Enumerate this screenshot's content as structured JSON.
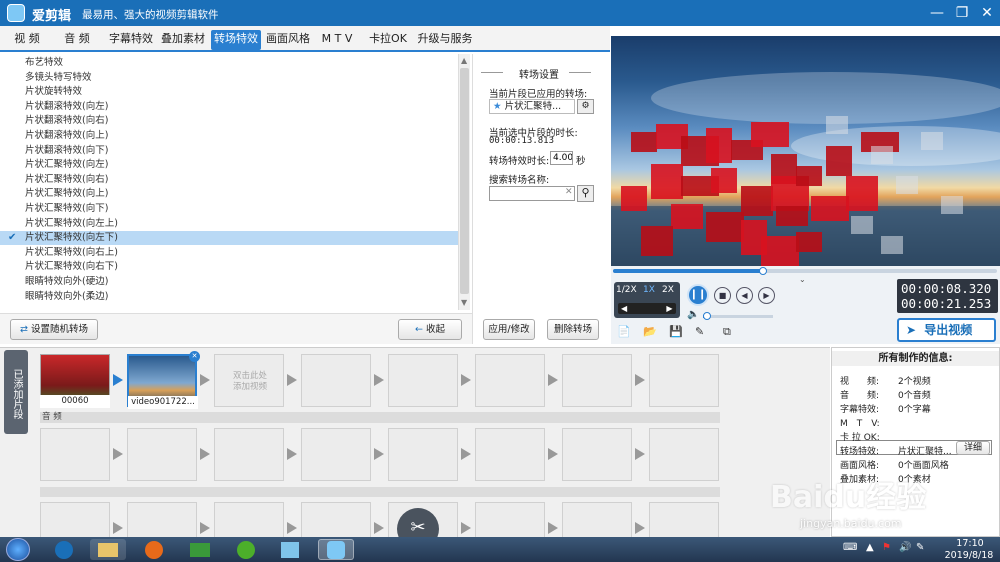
{
  "app": {
    "name": "爱剪辑",
    "slogan": "最易用、强大的视频剪辑软件"
  },
  "window_controls": [
    "minimize-icon",
    "restore-icon",
    "close-icon"
  ],
  "tabs": [
    "视 频",
    "音 频",
    "字幕特效",
    "叠加素材",
    "转场特效",
    "画面风格",
    "M T V",
    "卡拉OK",
    "升级与服务"
  ],
  "active_tab": "转场特效",
  "effects": [
    "布艺特效",
    "多镜头特写特效",
    "片状旋转特效",
    "片状翻滚特效(向左)",
    "片状翻滚特效(向右)",
    "片状翻滚特效(向上)",
    "片状翻滚特效(向下)",
    "片状汇聚特效(向左)",
    "片状汇聚特效(向右)",
    "片状汇聚特效(向上)",
    "片状汇聚特效(向下)",
    "片状汇聚特效(向左上)",
    "片状汇聚特效(向左下)",
    "片状汇聚特效(向右上)",
    "片状汇聚特效(向右下)",
    "眼睛特效向外(硬边)",
    "眼睛特效向外(柔边)"
  ],
  "selected_effect_index": 12,
  "bottom": {
    "random_btn": "设置随机转场",
    "collapse_btn": "收起"
  },
  "settings": {
    "title": "转场设置",
    "applied_label": "当前片段已应用的转场:",
    "applied_value": "片状汇聚特...",
    "duration_label": "当前选中片段的时长:",
    "duration_value": "00:00:13.813",
    "effect_len_label": "转场特效时长:",
    "effect_len_value": "4.00",
    "effect_len_unit": "秒",
    "search_label": "搜索转场名称:",
    "search_value": "",
    "apply_btn": "应用/修改",
    "delete_btn": "删除转场"
  },
  "player": {
    "speed_options": [
      "1/2X",
      "1X",
      "2X"
    ],
    "current_time": "00:00:08.320",
    "total_time": "00:00:21.253",
    "export_btn": "导出视频",
    "playback_progress": 0.39,
    "volume": 0.05
  },
  "timeline": {
    "side_label": "已添加片段",
    "clips": [
      {
        "label": "00060"
      },
      {
        "label": "video901722..."
      }
    ],
    "add_clip_hint": "双击此处添加视频",
    "audio_label": "音 频"
  },
  "info": {
    "title": "所有制作的信息:",
    "rows": [
      {
        "k": "视　　频:",
        "v": "2个视频"
      },
      {
        "k": "音　　频:",
        "v": "0个音频"
      },
      {
        "k": "字幕特效:",
        "v": "0个字幕"
      },
      {
        "k": "M　T　V:",
        "v": ""
      },
      {
        "k": "卡 拉 OK:",
        "v": ""
      },
      {
        "k": "转场特效:",
        "v": "片状汇聚特..."
      },
      {
        "k": "画面风格:",
        "v": "0个画面风格"
      },
      {
        "k": "叠加素材:",
        "v": "0个素材"
      }
    ],
    "detail_btn": "详细"
  },
  "taskbar": {
    "time": "17:10",
    "date": "2019/8/18"
  },
  "watermark": {
    "text": "Baidu经验",
    "sub": "jingyan.baidu.com"
  },
  "colors": {
    "accent": "#2a7fd0",
    "titlebar": "#1a6fb8",
    "selection": "#b9d9f5",
    "time_display": "#2e3540"
  }
}
